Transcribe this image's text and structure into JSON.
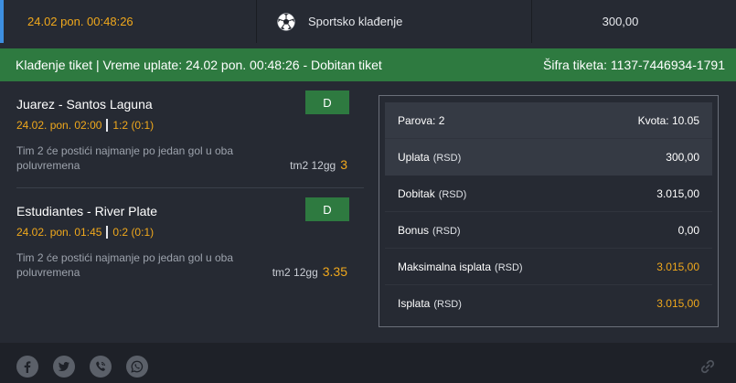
{
  "topbar": {
    "datetime": "24.02 pon. 00:48:26",
    "sport_label": "Sportsko klađenje",
    "amount": "300,00"
  },
  "ticket_header": {
    "title": "Klađenje tiket | Vreme uplate: 24.02 pon. 00:48:26 - Dobitan tiket",
    "code": "Šifra tiketa: 1137-7446934-1791"
  },
  "matches": [
    {
      "teams": "Juarez - Santos Laguna",
      "date": "24.02. pon. 02:00",
      "result": "1:2 (0:1)",
      "tip": "Tim 2 će postići najmanje po jedan gol u oba poluvremena",
      "code": "tm2 12gg",
      "odd": "3",
      "badge": "D"
    },
    {
      "teams": "Estudiantes - River Plate",
      "date": "24.02. pon. 01:45",
      "result": "0:2 (0:1)",
      "tip": "Tim 2 će postići najmanje po jedan gol u oba poluvremena",
      "code": "tm2 12gg",
      "odd": "3.35",
      "badge": "D"
    }
  ],
  "summary": {
    "pairs": "Parova: 2",
    "odds": "Kvota: 10.05",
    "unit": "(RSD)",
    "rows": [
      {
        "label": "Uplata",
        "value": "300,00"
      },
      {
        "label": "Dobitak",
        "value": "3.015,00"
      },
      {
        "label": "Bonus",
        "value": "0,00"
      },
      {
        "label": "Maksimalna isplata",
        "value": "3.015,00"
      },
      {
        "label": "Isplata",
        "value": "3.015,00"
      }
    ]
  },
  "colors": {
    "accent": "#f0a81c",
    "green": "#2e7a40",
    "blue_stripe": "#3d8fe0"
  },
  "icons": [
    "soccer-ball-icon",
    "facebook-icon",
    "twitter-icon",
    "viber-icon",
    "whatsapp-icon",
    "link-icon"
  ]
}
